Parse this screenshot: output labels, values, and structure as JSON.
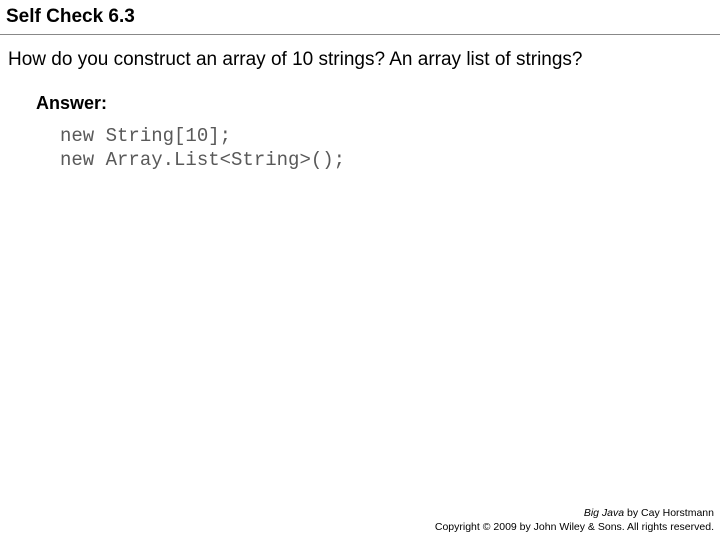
{
  "title": "Self Check 6.3",
  "question": "How do you construct an array of 10 strings? An array list of strings?",
  "answer_label": "Answer:",
  "code": "new String[10];\nnew Array.List<String>();",
  "footer": {
    "book_title": "Big Java",
    "byline": " by Cay Horstmann",
    "copyright": "Copyright © 2009 by John Wiley & Sons. All rights reserved."
  }
}
